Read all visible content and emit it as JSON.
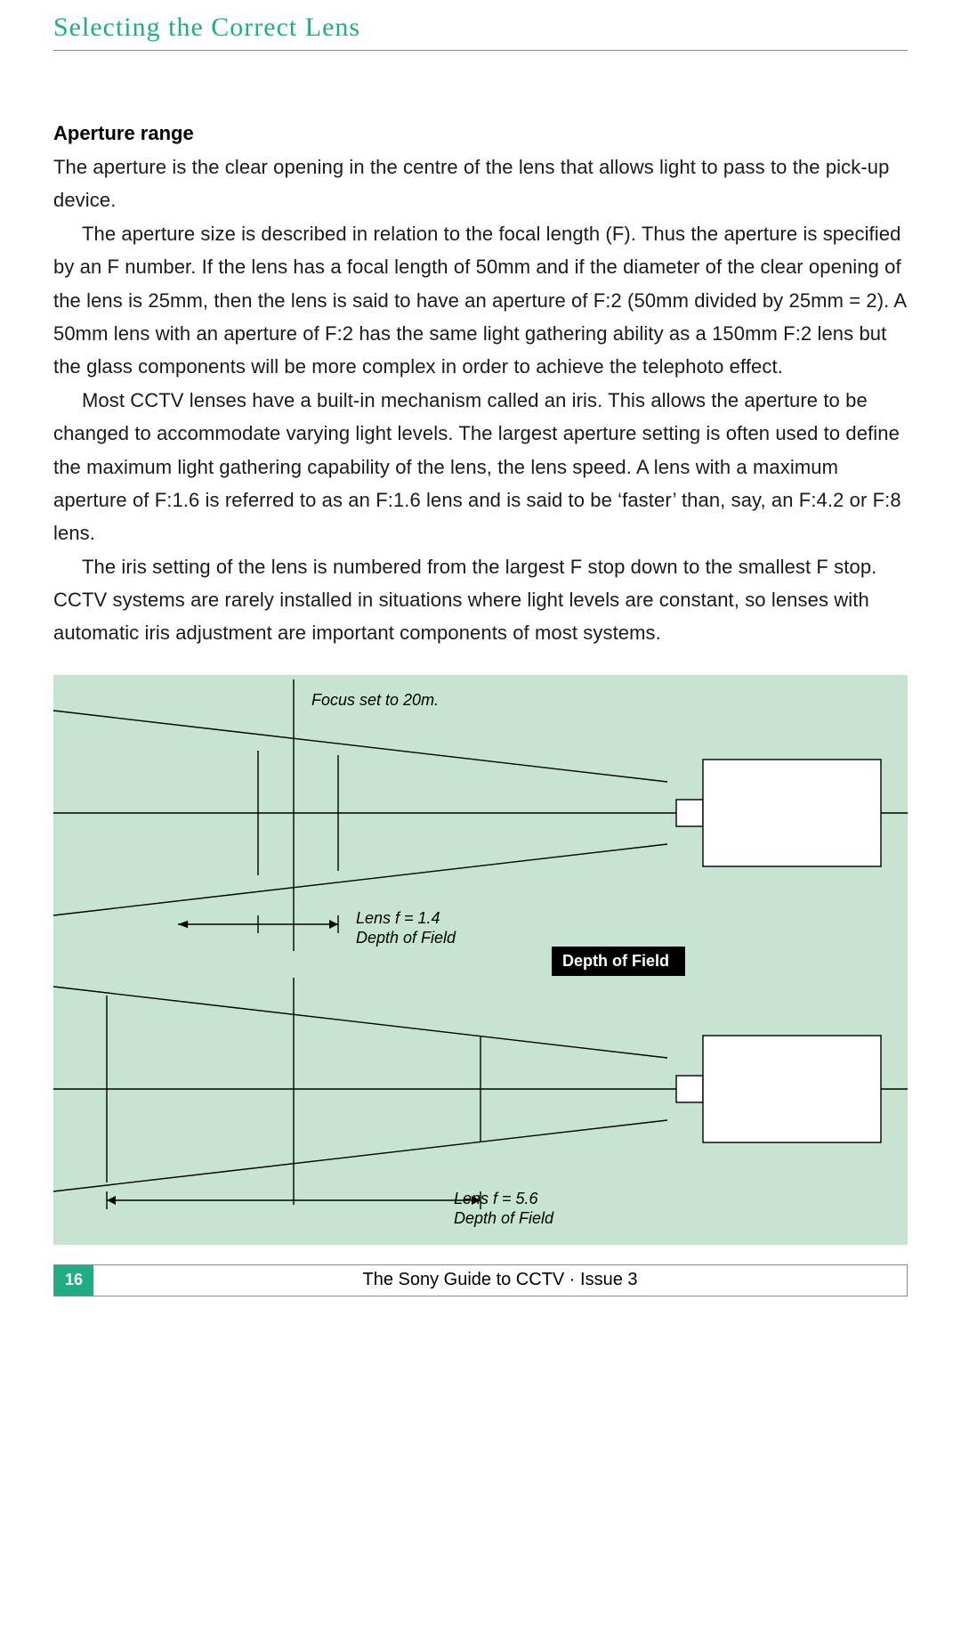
{
  "chapter_title": "Selecting the Correct Lens",
  "section_heading": "Aperture range",
  "paragraphs": {
    "p1": "The aperture is the clear opening in the centre of the lens that allows light to pass to the pick-up device.",
    "p2": "The aperture size is described in relation to the focal length (F). Thus the aperture is specified by an F number. If the lens has a focal length of 50mm and if the diameter of the clear opening of the lens is 25mm, then the lens is said to have an aperture of F:2 (50mm divided by 25mm = 2). A 50mm lens with an aperture of F:2 has the same light gathering ability as a 150mm F:2 lens but the glass components will be more complex in order to achieve the telephoto effect.",
    "p3": "Most CCTV lenses have a built-in mechanism called an iris. This allows the aperture to be changed to accommodate varying light levels. The largest aperture setting is often used to define the maximum light gathering capability of the lens, the lens speed. A lens with a maximum aperture of F:1.6 is referred to as an F:1.6 lens and is said to be ‘faster’ than, say, an F:4.2 or F:8 lens.",
    "p4": "The iris setting of the lens is numbered from the largest F stop down to the smallest F stop. CCTV systems are rarely installed in situations where light levels are constant, so lenses with automatic iris adjustment are important components of most systems."
  },
  "figure": {
    "focus_label": "Focus set to 20m.",
    "lens1_line1": "Lens f = 1.4",
    "lens1_line2": "Depth of Field",
    "lens2_line1": "Lens f = 5.6",
    "lens2_line2": "Depth of Field",
    "caption_box": "Depth of Field"
  },
  "footer": {
    "page_number": "16",
    "text": "The Sony Guide to CCTV · Issue 3"
  },
  "colors": {
    "accent_green": "#1fae83",
    "figure_bg": "#c7e4d2"
  }
}
